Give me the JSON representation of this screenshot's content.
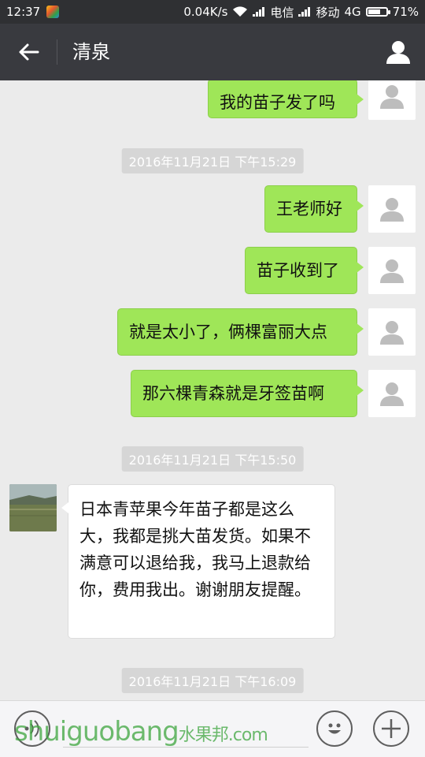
{
  "status_bar": {
    "time": "12:37",
    "net_speed": "0.04K/s",
    "carrier1": "电信",
    "carrier2": "移动",
    "network": "4G",
    "battery": "71%",
    "battery_level": 0.71
  },
  "header": {
    "title": "清泉",
    "back_icon": "back-arrow-icon",
    "contact_icon": "person-icon"
  },
  "messages": [
    {
      "type": "out",
      "text": "我的苗子发了吗"
    },
    {
      "type": "time",
      "text": "2016年11月21日 下午15:29"
    },
    {
      "type": "out",
      "text": "王老师好"
    },
    {
      "type": "out",
      "text": "苗子收到了"
    },
    {
      "type": "out",
      "text": "就是太小了，俩棵富丽大点"
    },
    {
      "type": "out",
      "text": "那六棵青森就是牙签苗啊"
    },
    {
      "type": "time",
      "text": "2016年11月21日 下午15:50"
    },
    {
      "type": "in",
      "text": "日本青苹果今年苗子都是这么大，我都是挑大苗发货。如果不满意可以退给我，我马上退款给你，费用我出。谢谢朋友提醒。"
    },
    {
      "type": "time",
      "text": "2016年11月21日 下午16:09"
    }
  ],
  "input_bar": {
    "voice_icon": "voice-icon",
    "emoji_icon": "smiley-icon",
    "plus_icon": "plus-icon",
    "text_value": ""
  },
  "watermark": {
    "text": "shuiguobang",
    "cn": "水果邦",
    "suffix": ".com"
  },
  "colors": {
    "title_bar": "#393a3f",
    "status_bar": "#2f3033",
    "chat_bg": "#ebebeb",
    "out_bubble": "#9fe658",
    "in_bubble": "#ffffff"
  }
}
